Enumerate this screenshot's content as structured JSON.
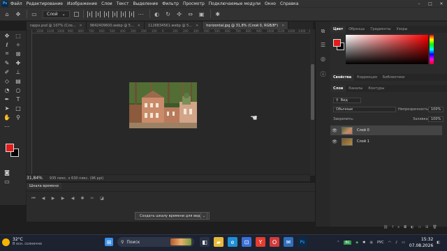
{
  "app": {
    "logo": "Ps"
  },
  "menu": [
    "Файл",
    "Редактирование",
    "Изображение",
    "Слои",
    "Текст",
    "Выделение",
    "Фильтр",
    "Просмотр",
    "Подключаемые модули",
    "Окно",
    "Справка"
  ],
  "window_controls": {
    "minimize": "–",
    "maximize": "□",
    "close": "✕"
  },
  "options": {
    "layer_select": "Слой",
    "layer_select_icon": "chevron-down-icon"
  },
  "tabs": [
    {
      "label": "rappx.psd @ 107% (Сло...",
      "active": false
    },
    {
      "label": "9842409600.webp @ 5...",
      "active": false
    },
    {
      "label": "1126834561.webp @ 5...",
      "active": false
    },
    {
      "label": "horizontal.jpg @ 31,8% (Слой 0, RGB/8*)",
      "active": true
    }
  ],
  "ruler_ticks": [
    "1200",
    "1100",
    "1000",
    "900",
    "800",
    "700",
    "600",
    "500",
    "400",
    "300",
    "200",
    "100",
    "0",
    "100",
    "200",
    "300",
    "400",
    "500",
    "600",
    "700",
    "800",
    "900",
    "1000",
    "1100",
    "1200",
    "1300",
    "1400"
  ],
  "status": {
    "zoom": "31,84%",
    "docinfo": "935 пикс. x 630 пикс. (96 ppi)"
  },
  "timeline": {
    "tab": "Шкала времени",
    "create_button": "Создать шкалу времени для видео"
  },
  "color_panel": {
    "tabs": [
      "Цвет",
      "Образцы",
      "Градиенты",
      "Узоры"
    ],
    "active": 0,
    "fg_color": "#e31b1b",
    "bg_color": "#000000"
  },
  "props_panel": {
    "tabs": [
      "Свойства",
      "Коррекция",
      "Библиотеки"
    ],
    "active": 0
  },
  "layers_panel": {
    "tabs": [
      "Слои",
      "Каналы",
      "Контуры"
    ],
    "active": 0,
    "filter": "Вид",
    "blend": "Обычные",
    "opacity_label": "Непрозрачность:",
    "opacity_value": "100%",
    "lock_label": "Закрепить:",
    "fill_label": "Заливка:",
    "fill_value": "100%",
    "layers": [
      {
        "name": "Слой 0",
        "selected": true
      },
      {
        "name": "Слой 1",
        "selected": false
      }
    ]
  },
  "taskbar": {
    "weather_temp": "32°C",
    "weather_cond": "В осн. солнечно",
    "search": "Поиск",
    "lang": "РУС",
    "time": "15:32",
    "date": "07.08.2026"
  }
}
